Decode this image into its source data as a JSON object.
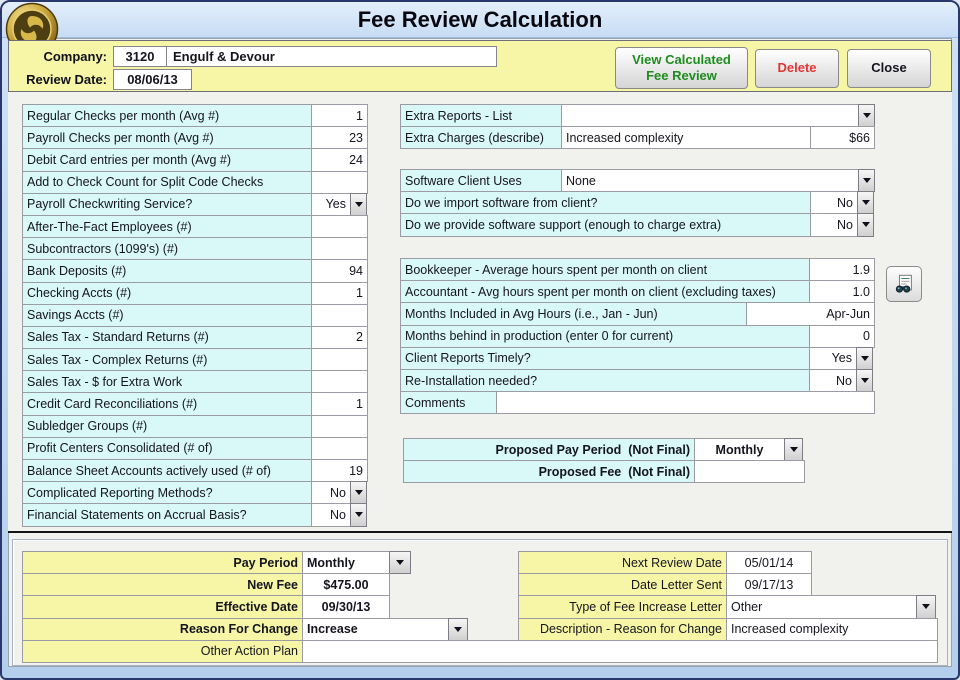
{
  "window": {
    "title": "Fee Review Calculation"
  },
  "colors": {
    "titlebar_blue": "#cfe3f7",
    "panel_yellow": "#f6f6a6",
    "label_cyan": "#d9f8f8",
    "accent_green": "#1e8c1e",
    "accent_red": "#e03535"
  },
  "icons": {
    "logo": "gold-coin-swirl-logo",
    "lookup": "binoculars-report-icon",
    "dropdown": "chevron-down"
  },
  "header": {
    "company_label": "Company:",
    "company_number": "3120",
    "company_name": "Engulf & Devour",
    "review_date_label": "Review Date:",
    "review_date": "08/06/13",
    "buttons": {
      "view_line1": "View Calculated",
      "view_line2": "Fee Review",
      "delete": "Delete",
      "close": "Close"
    }
  },
  "left": {
    "rows": [
      {
        "label": "Regular Checks per month (Avg #)",
        "value": "1"
      },
      {
        "label": "Payroll Checks per month (Avg #)",
        "value": "23"
      },
      {
        "label": "Debit Card entries per month (Avg #)",
        "value": "24"
      },
      {
        "label": "Add to Check Count for Split Code Checks",
        "value": ""
      },
      {
        "label": "Payroll Checkwriting Service?",
        "value": "Yes",
        "dropdown": true
      },
      {
        "label": "After-The-Fact Employees (#)",
        "value": ""
      },
      {
        "label": "Subcontractors (1099's) (#)",
        "value": ""
      },
      {
        "label": "Bank Deposits (#)",
        "value": "94"
      },
      {
        "label": "Checking Accts (#)",
        "value": "1"
      },
      {
        "label": "Savings Accts (#)",
        "value": ""
      },
      {
        "label": "Sales Tax - Standard Returns (#)",
        "value": "2"
      },
      {
        "label": "Sales Tax - Complex Returns (#)",
        "value": ""
      },
      {
        "label": "Sales Tax - $ for Extra Work",
        "value": ""
      },
      {
        "label": "Credit Card Reconciliations (#)",
        "value": "1"
      },
      {
        "label": "Subledger Groups (#)",
        "value": ""
      },
      {
        "label": "Profit Centers Consolidated (# of)",
        "value": ""
      },
      {
        "label": "Balance Sheet Accounts actively used (# of)",
        "value": "19"
      },
      {
        "label": "Complicated Reporting Methods?",
        "value": "No",
        "dropdown": true
      },
      {
        "label": "Financial Statements on Accrual Basis?",
        "value": "No",
        "dropdown": true
      }
    ]
  },
  "right": {
    "extra": {
      "list_label": "Extra Reports - List",
      "list_value": "",
      "charges_label": "Extra Charges (describe)",
      "charges_desc": "Increased complexity",
      "charges_amount": "$66"
    },
    "software": {
      "uses_label": "Software Client Uses",
      "uses_value": "None",
      "import_label": "Do we import software from client?",
      "import_value": "No",
      "support_label": "Do we provide software support (enough to charge extra)",
      "support_value": "No"
    },
    "hours": {
      "bookkeeper_label": "Bookkeeper - Average hours spent per month on client",
      "bookkeeper_value": "1.9",
      "accountant_label": "Accountant - Avg hours spent per month on client (excluding taxes)",
      "accountant_value": "1.0",
      "months_label": "Months Included in Avg Hours (i.e., Jan - Jun)",
      "months_value": "Apr-Jun",
      "behind_label": "Months behind in production (enter 0 for current)",
      "behind_value": "0",
      "timely_label": "Client Reports Timely?",
      "timely_value": "Yes",
      "reinstall_label": "Re-Installation needed?",
      "reinstall_value": "No",
      "comments_label": "Comments",
      "comments_value": ""
    },
    "proposed": {
      "period_label": "Proposed Pay Period  (Not Final)",
      "period_value": "Monthly",
      "fee_label": "Proposed Fee  (Not Final)",
      "fee_value": ""
    }
  },
  "bottom": {
    "left": {
      "pay_period_label": "Pay Period",
      "pay_period_value": "Monthly",
      "new_fee_label": "New Fee",
      "new_fee_value": "$475.00",
      "effective_label": "Effective Date",
      "effective_value": "09/30/13",
      "reason_label": "Reason For Change",
      "reason_value": "Increase",
      "other_label": "Other Action Plan",
      "other_value": ""
    },
    "right": {
      "next_review_label": "Next Review Date",
      "next_review_value": "05/01/14",
      "letter_sent_label": "Date Letter Sent",
      "letter_sent_value": "09/17/13",
      "letter_type_label": "Type of Fee Increase Letter",
      "letter_type_value": "Other",
      "description_label": "Description - Reason for Change",
      "description_value": "Increased complexity"
    }
  }
}
